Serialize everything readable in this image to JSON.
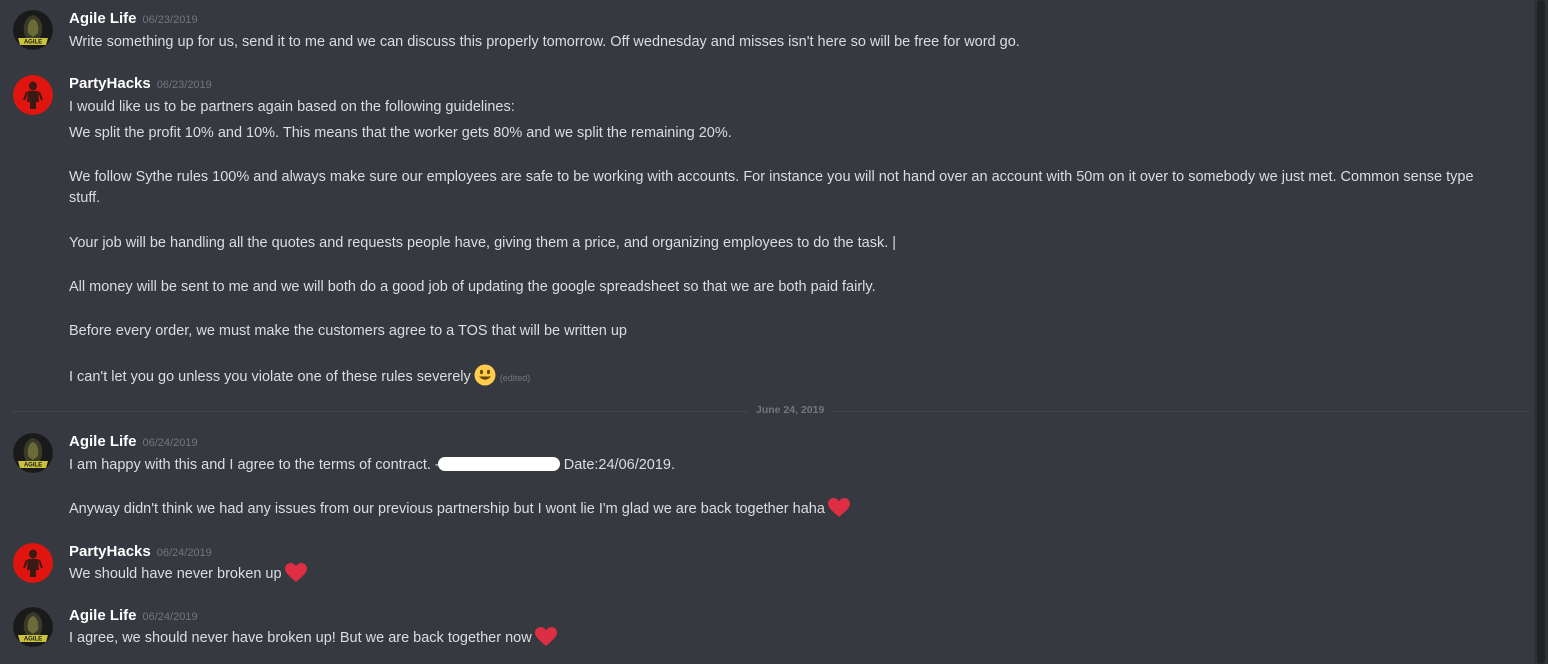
{
  "messages": [
    {
      "username": "Agile Life",
      "timestamp": "06/23/2019",
      "lines": [
        "Write something up for us, send it to me and we can discuss this properly tomorrow. Off wednesday and misses isn't here so will be free for word go."
      ]
    },
    {
      "username": "PartyHacks",
      "timestamp": "06/23/2019",
      "lines": [
        "I would like us to be partners again based on the following guidelines:",
        "We split the profit 10% and 10%. This means that the worker gets 80% and we split the remaining 20%.",
        "We follow Sythe rules 100% and always make sure our employees are safe to be working with accounts. For instance you will not hand over an account with 50m on it over to somebody we just met. Common sense type",
        "stuff.",
        "Your job will be handling all the quotes and requests people have, giving them a price, and organizing employees to do the task. |",
        "All money will be sent to me and  we will both do a good job of updating the google spreadsheet so that we are both paid fairly.",
        "Before every order, we must make the customers agree to a TOS that will be written up",
        "I can't let you go unless you violate one of these rules severely"
      ],
      "edited_label": "(edited)"
    },
    {
      "divider_label": "June 24, 2019"
    },
    {
      "username": "Agile Life",
      "timestamp": "06/24/2019",
      "lines": [
        "I am happy with this and I agree to the terms of contract. -",
        "Date:24/06/2019.",
        "Anyway didn't think we had any issues from our previous partnership but I wont lie I'm glad we are back together haha"
      ]
    },
    {
      "username": "PartyHacks",
      "timestamp": "06/24/2019",
      "lines": [
        "We should have never broken up"
      ]
    },
    {
      "username": "Agile Life",
      "timestamp": "06/24/2019",
      "lines": [
        "I agree, we should never have broken up! But we are back together now"
      ]
    }
  ],
  "icons": {
    "smile": "smiley-emoji-icon",
    "heart": "heart-emoji-icon"
  },
  "colors": {
    "background": "#36393f",
    "username": "#ffffff",
    "text": "#dcddde",
    "muted": "#72767d",
    "heart": "#dd2e44",
    "smiley": "#ffcc4d"
  }
}
